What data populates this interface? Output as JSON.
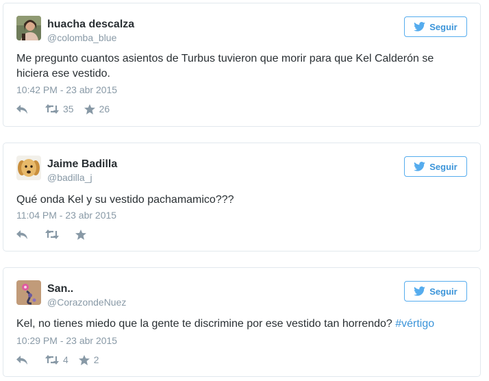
{
  "follow_label": "Seguir",
  "accent_color": "#55acee",
  "tweets": [
    {
      "name": "huacha descalza",
      "handle": "@colomba_blue",
      "text": "Me pregunto cuantos asientos de Turbus tuvieron que morir para que Kel Calderón se hiciera ese vestido.",
      "date": "10:42 PM - 23 abr 2015",
      "retweets": "35",
      "favorites": "26"
    },
    {
      "name": "Jaime Badilla",
      "handle": "@badilla_j",
      "text": "Qué onda Kel y su vestido pachamamico???",
      "date": "11:04 PM - 23 abr 2015",
      "retweets": "",
      "favorites": ""
    },
    {
      "name": "San..",
      "handle": "@CorazondeNuez",
      "text": "Kel, no tienes miedo que la gente te discrimine por ese vestido tan horrendo? ",
      "hashtag": "#vértigo",
      "date": "10:29 PM - 23 abr 2015",
      "retweets": "4",
      "favorites": "2"
    }
  ]
}
